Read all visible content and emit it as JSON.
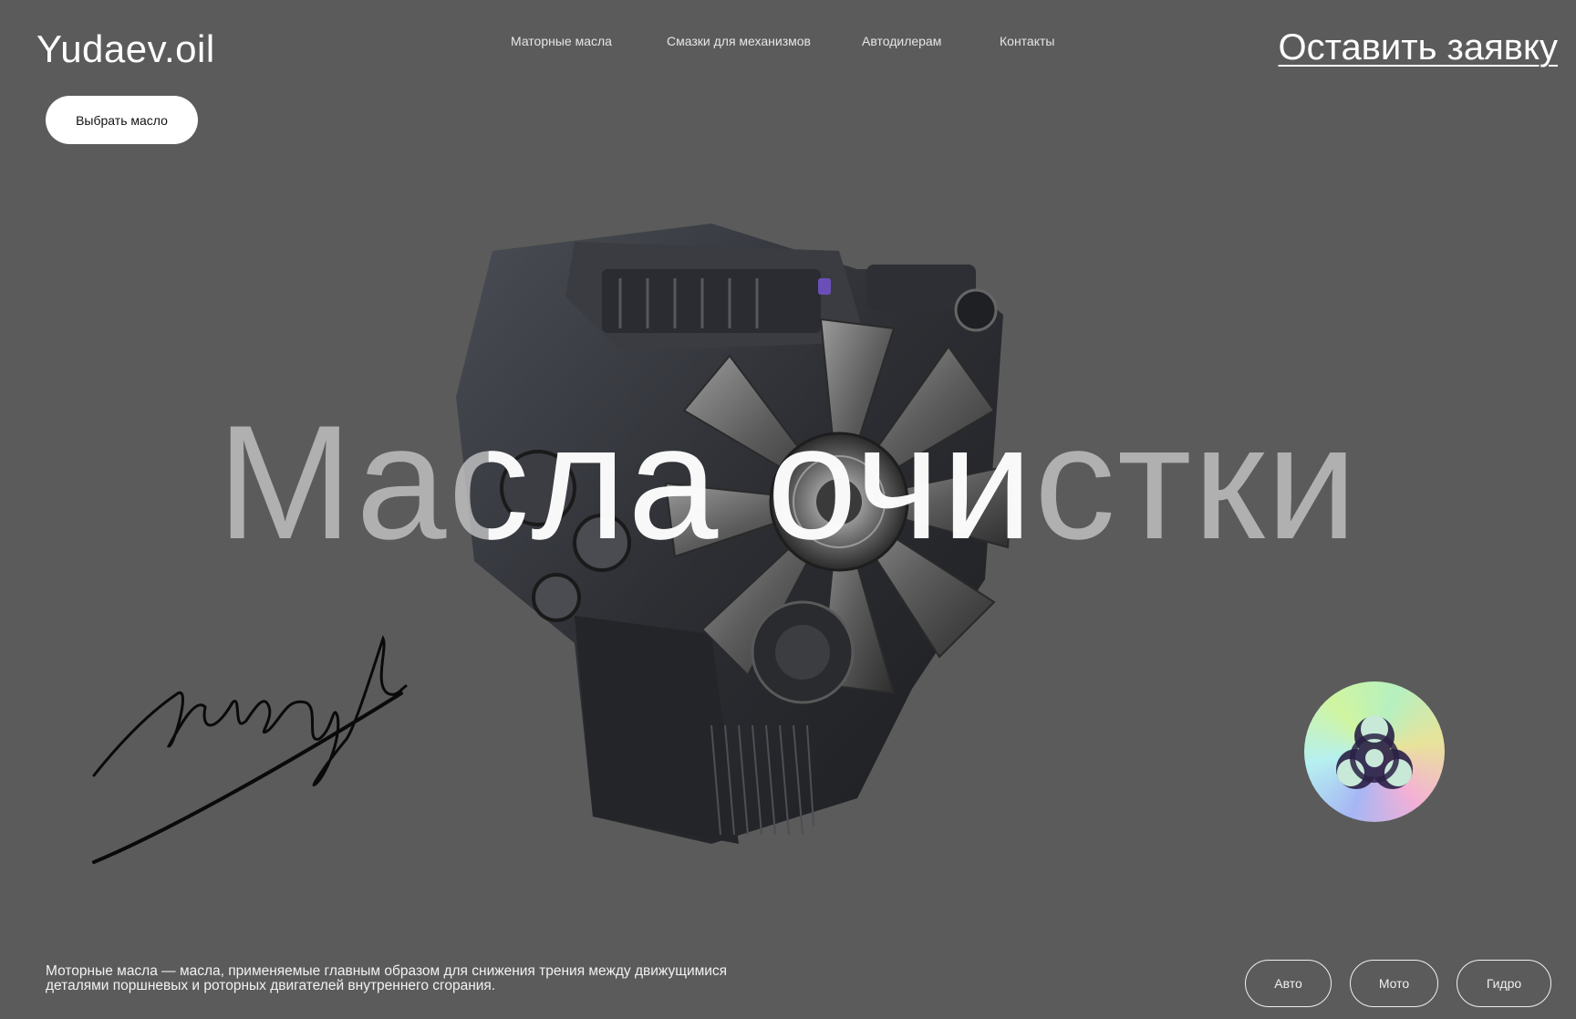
{
  "header": {
    "logo": "Yudaev.oil",
    "nav": [
      {
        "label": "Маторные масла"
      },
      {
        "label": "Смазки для механизмов"
      },
      {
        "label": "Автодилерам"
      },
      {
        "label": "Контакты"
      }
    ],
    "cta_label": "Оставить заявку"
  },
  "hero": {
    "choose_button": "Выбрать масло",
    "headline": "Масла очистки",
    "image": "engine",
    "badge_icon": "biohazard-icon",
    "signature": "Yudaev"
  },
  "footer": {
    "description": "Моторные масла — масла, применяемые главным образом для снижения трения между движущимися деталями поршневых и роторных двигателей внутреннего сгорания.",
    "categories": [
      "Авто",
      "Мото",
      "Гидро"
    ]
  },
  "colors": {
    "background": "#5b5b5b",
    "text": "#ffffff",
    "button_bg": "#ffffff"
  }
}
